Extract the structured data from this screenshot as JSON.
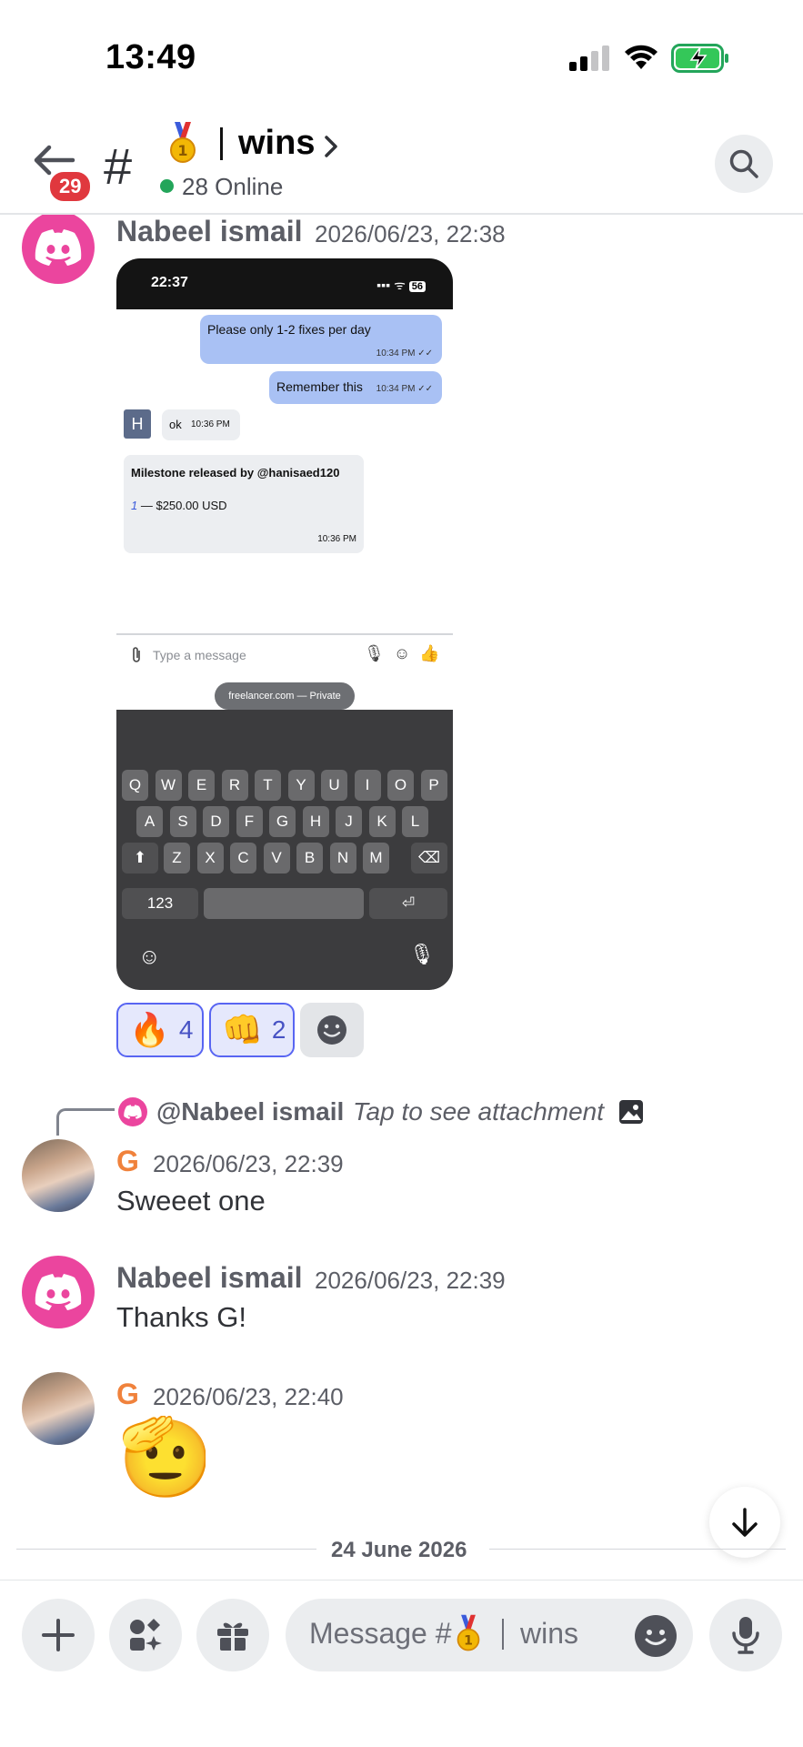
{
  "status_bar": {
    "time": "13:49"
  },
  "header": {
    "back_badge": "29",
    "channel_prefix": "#",
    "channel_name": "wins",
    "online": "28 Online"
  },
  "messages": [
    {
      "author": "Nabeel ismail",
      "timestamp": "2026/06/23, 22:38",
      "attachment": {
        "phone_time": "22:37",
        "battery": "56",
        "bubbles": [
          {
            "text": "Please only 1-2 fixes per day",
            "meta": "10:34 PM ✓✓"
          },
          {
            "text": "Remember this",
            "meta": "10:34 PM ✓✓"
          }
        ],
        "h_initial": "H",
        "ok_text": "ok",
        "ok_time": "10:36 PM",
        "milestone_title": "Milestone released by @hanisaed120",
        "milestone_index": "1",
        "milestone_amount": "— $250.00 USD",
        "milestone_time": "10:36 PM",
        "composer_placeholder": "Type a message",
        "site_pill": "freelancer.com — Private",
        "keyboard_rows": [
          [
            "Q",
            "W",
            "E",
            "R",
            "T",
            "Y",
            "U",
            "I",
            "O",
            "P"
          ],
          [
            "A",
            "S",
            "D",
            "F",
            "G",
            "H",
            "J",
            "K",
            "L"
          ],
          [
            "Z",
            "X",
            "C",
            "V",
            "B",
            "N",
            "M"
          ]
        ],
        "key_123": "123"
      },
      "reactions": [
        {
          "emoji": "🔥",
          "count": "4"
        },
        {
          "emoji": "👊",
          "count": "2"
        }
      ]
    },
    {
      "reply_to": {
        "author": "@Nabeel ismail",
        "text": "Tap to see attachment"
      },
      "author": "G",
      "timestamp": "2026/06/23, 22:39",
      "text": "Sweeet one"
    },
    {
      "author": "Nabeel ismail",
      "timestamp": "2026/06/23, 22:39",
      "text": "Thanks G!"
    },
    {
      "author": "G",
      "timestamp": "2026/06/23, 22:40",
      "emoji": "🫡"
    }
  ],
  "date_divider": "24 June 2026",
  "composer": {
    "placeholder_prefix": "Message #",
    "placeholder_channel": "wins"
  },
  "icons": {
    "back": "arrow-left-icon",
    "search": "search-icon",
    "plus": "plus-icon",
    "apps": "apps-icon",
    "gift": "gift-icon",
    "emoji": "emoji-icon",
    "mic": "microphone-icon",
    "scroll_down": "arrow-down-icon"
  },
  "colors": {
    "discord_pink": "#eb459e",
    "online_green": "#23a55a",
    "badge_red": "#e0383e",
    "reaction_blurple": "#5865f2",
    "author_orange": "#f0823c"
  }
}
